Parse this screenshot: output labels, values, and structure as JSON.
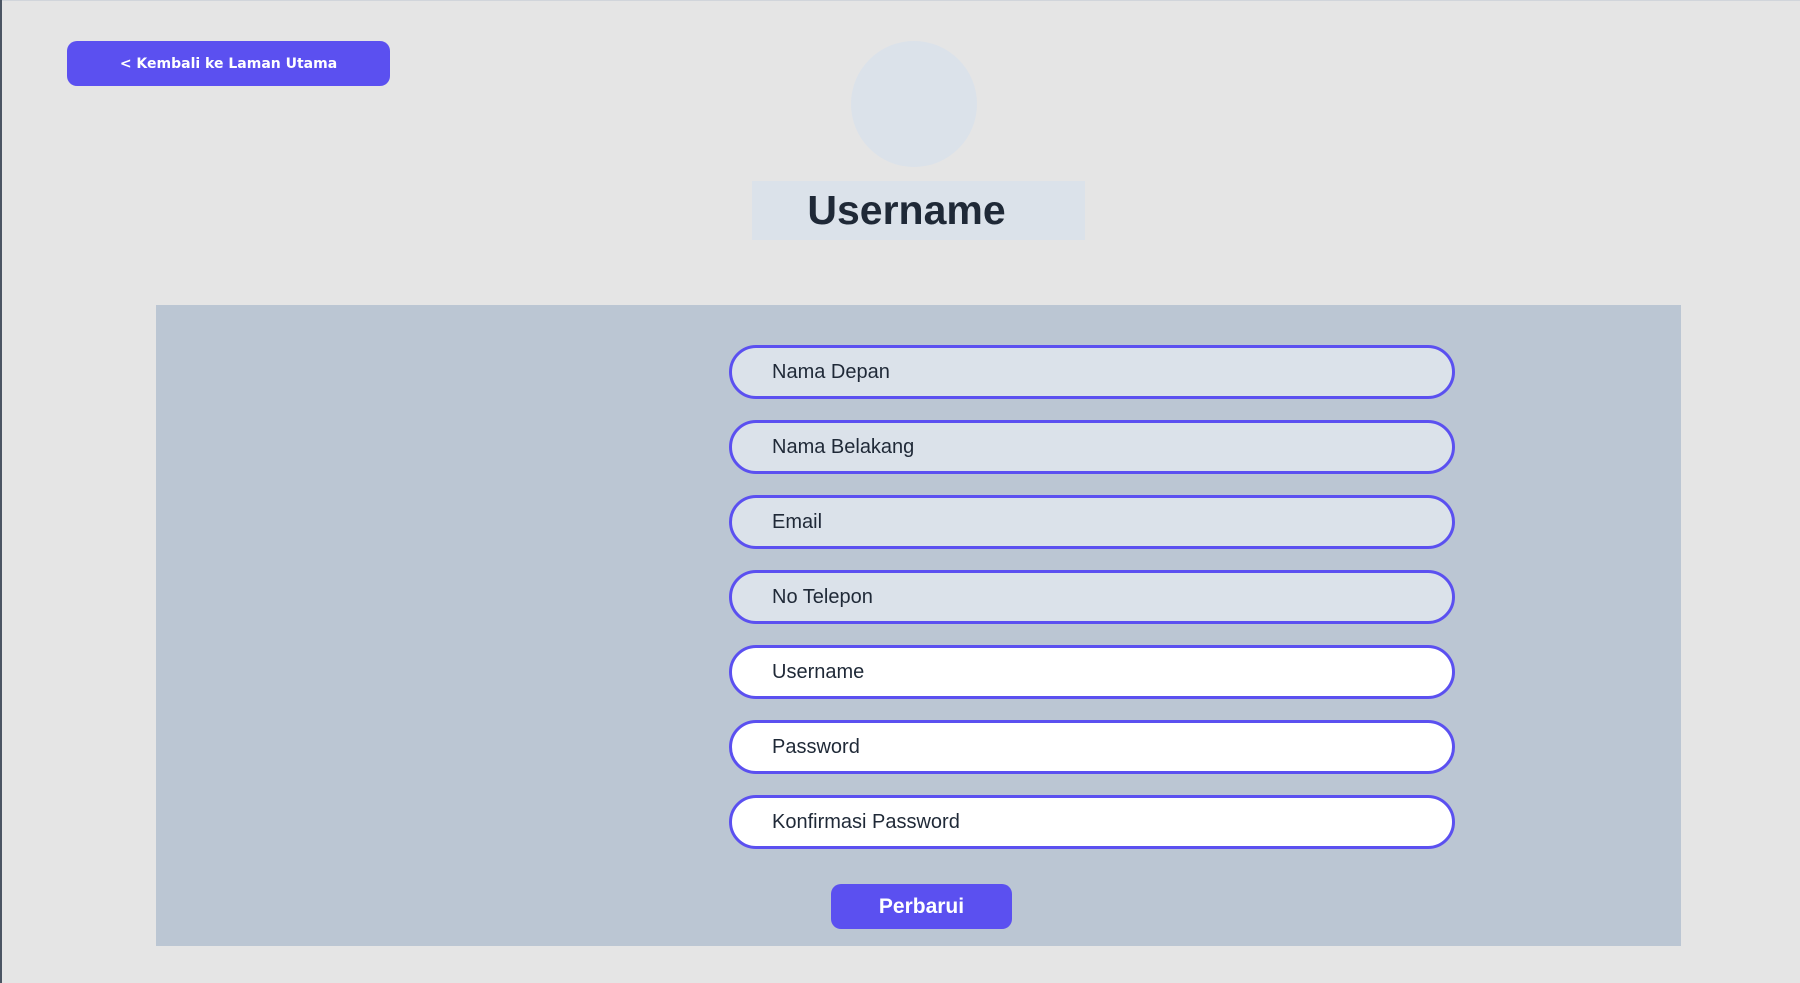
{
  "header": {
    "back_label": "< Kembali ke Laman Utama",
    "title": "Username"
  },
  "form": {
    "fields": [
      {
        "placeholder": "Nama Depan",
        "value": ""
      },
      {
        "placeholder": "Nama Belakang",
        "value": ""
      },
      {
        "placeholder": "Email",
        "value": ""
      },
      {
        "placeholder": "No Telepon",
        "value": ""
      },
      {
        "placeholder": "Username",
        "value": ""
      },
      {
        "placeholder": "Password",
        "value": ""
      },
      {
        "placeholder": "Konfirmasi Password",
        "value": ""
      }
    ],
    "submit_label": "Perbarui"
  },
  "colors": {
    "accent": "#5b50f0",
    "background": "#e5e5e5",
    "panel": "#bbc6d3",
    "readonly_field": "#dbe2ea",
    "editable_field": "#ffffff"
  }
}
